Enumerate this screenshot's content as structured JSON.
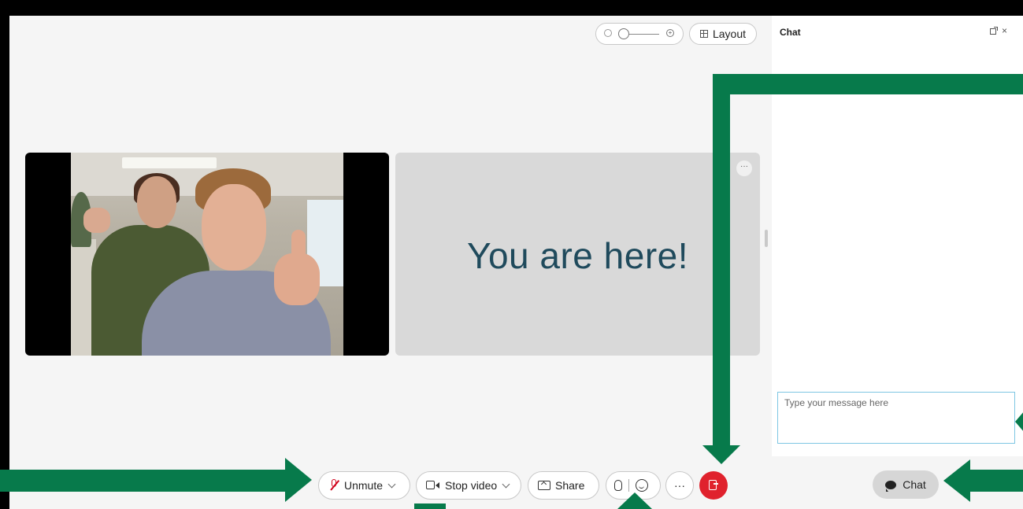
{
  "colors": {
    "accent": "#077a4b",
    "end_call": "#e0222d",
    "self_label": "#1f4a5c",
    "input_focus": "#7ec6e3"
  },
  "header": {
    "layout_label": "Layout",
    "zoom_out_icon": "zoom-out-icon",
    "zoom_in_icon": "zoom-in-icon"
  },
  "stage": {
    "self_tile_label": "You are here!",
    "tile_menu_label": "···"
  },
  "chat_panel": {
    "title": "Chat",
    "popout_icon": "popout-icon",
    "close_label": "×",
    "input_placeholder": "Type your message here"
  },
  "toolbar": {
    "unmute_label": "Unmute",
    "stop_video_label": "Stop video",
    "share_label": "Share",
    "more_label": "···",
    "chat_label": "Chat"
  }
}
